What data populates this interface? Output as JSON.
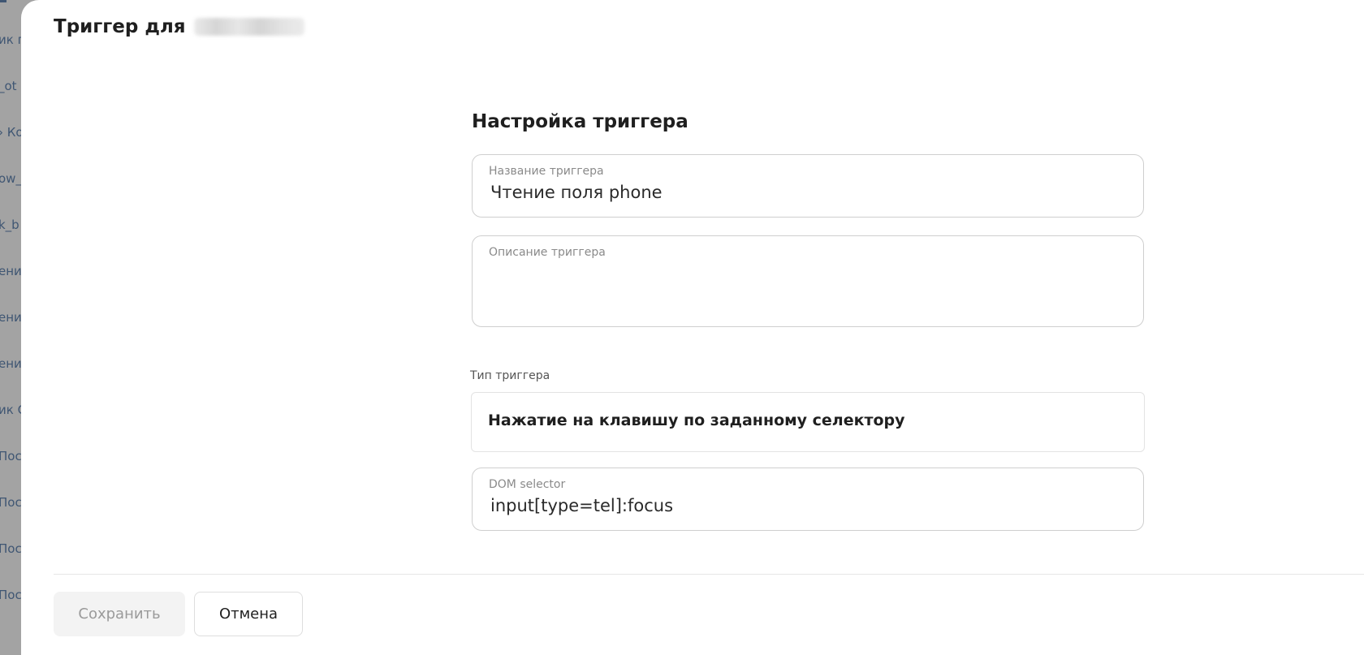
{
  "backdrop": {
    "items": [
      "ик п",
      "_ot",
      "› Ко",
      "ow_",
      "k_b",
      "ени",
      "ени",
      "ени",
      "ик С",
      "Пос",
      "Пос",
      "Пос",
      "Пос"
    ]
  },
  "panel": {
    "title": "Триггер для"
  },
  "form": {
    "heading": "Настройка триггера",
    "name_field": {
      "label": "Название триггера",
      "value": "Чтение поля phone"
    },
    "description_field": {
      "label": "Описание триггера",
      "value": ""
    },
    "type_section": {
      "label": "Тип триггера",
      "selected": "Нажатие на клавишу по заданному селектору"
    },
    "selector_field": {
      "label": "DOM selector",
      "value": "input[type=tel]:focus"
    }
  },
  "footer": {
    "save_label": "Сохранить",
    "cancel_label": "Отмена"
  }
}
